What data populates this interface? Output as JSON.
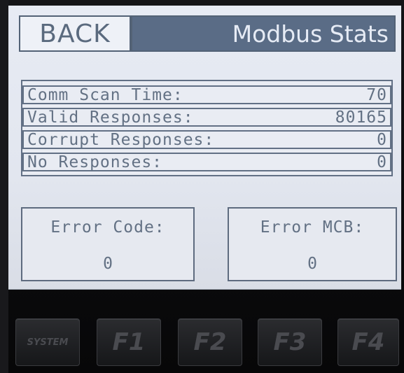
{
  "header": {
    "back_label": "BACK",
    "title": "Modbus Stats"
  },
  "stats": [
    {
      "label": "Comm Scan Time:",
      "value": "70"
    },
    {
      "label": "Valid Responses:",
      "value": "80165"
    },
    {
      "label": "Corrupt Responses:",
      "value": "0"
    },
    {
      "label": "No Responses:",
      "value": "0"
    }
  ],
  "errors": {
    "code": {
      "label": "Error Code:",
      "value": "0"
    },
    "mcb": {
      "label": "Error MCB:",
      "value": "0"
    }
  },
  "keys": {
    "system": "SYSTEM",
    "f1": "F1",
    "f2": "F2",
    "f3": "F3",
    "f4": "F4"
  },
  "colors": {
    "screen_bg": "#e4e8f1",
    "lcd_text": "#637184",
    "title_bar": "#5a6c86",
    "bezel": "#0c0c0e"
  }
}
